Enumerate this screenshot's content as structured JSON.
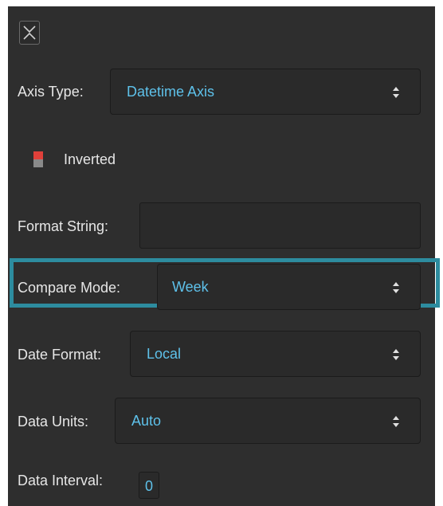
{
  "panel": {
    "collapse_icon": "collapse-icon",
    "axis_type": {
      "label": "Axis Type:",
      "value": "Datetime Axis"
    },
    "inverted": {
      "label": "Inverted",
      "checked": true,
      "accent": "#e0403a"
    },
    "format_string": {
      "label": "Format String:",
      "value": ""
    },
    "compare_mode": {
      "label": "Compare Mode:",
      "value": "Week",
      "highlight_color": "#2d8c9f"
    },
    "date_format": {
      "label": "Date Format:",
      "value": "Local"
    },
    "data_units": {
      "label": "Data Units:",
      "value": "Auto"
    },
    "data_interval": {
      "label": "Data Interval:",
      "value": "0"
    },
    "value_color": "#5ec1ea"
  }
}
